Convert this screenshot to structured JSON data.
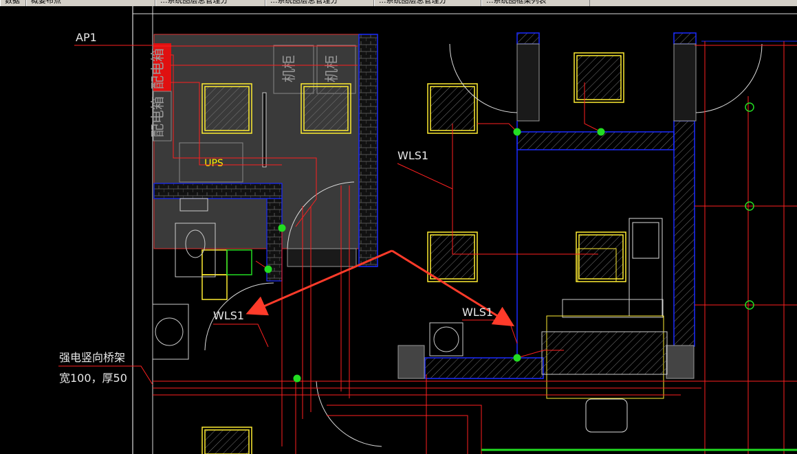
{
  "tabs": [
    {
      "label": "数据"
    },
    {
      "label": "概要布点"
    },
    {
      "label": "...系统图层总管理分"
    },
    {
      "label": "...系统图层总管理分"
    },
    {
      "label": "...系统图层总管理分"
    },
    {
      "label": "...系统图框架列表"
    }
  ],
  "labels": {
    "ap1": "AP1",
    "wls1_top": "WLS1",
    "wls1_left": "WLS1",
    "wls1_right": "WLS1",
    "ups": "UPS",
    "tray_line1": "强电竖向桥架",
    "tray_line2": "宽100，厚50",
    "cabinet_a": "机柜",
    "cabinet_b": "机柜",
    "dist_box_a": "配电箱",
    "dist_box_b": "配电箱"
  },
  "colors": {
    "background": "#000000",
    "wall_blue": "#1a2bff",
    "circuit_red": "#ff2020",
    "fixture_yellow": "#ffee33",
    "junction_green": "#22dd22",
    "arrow_red": "#ff3b2a"
  }
}
